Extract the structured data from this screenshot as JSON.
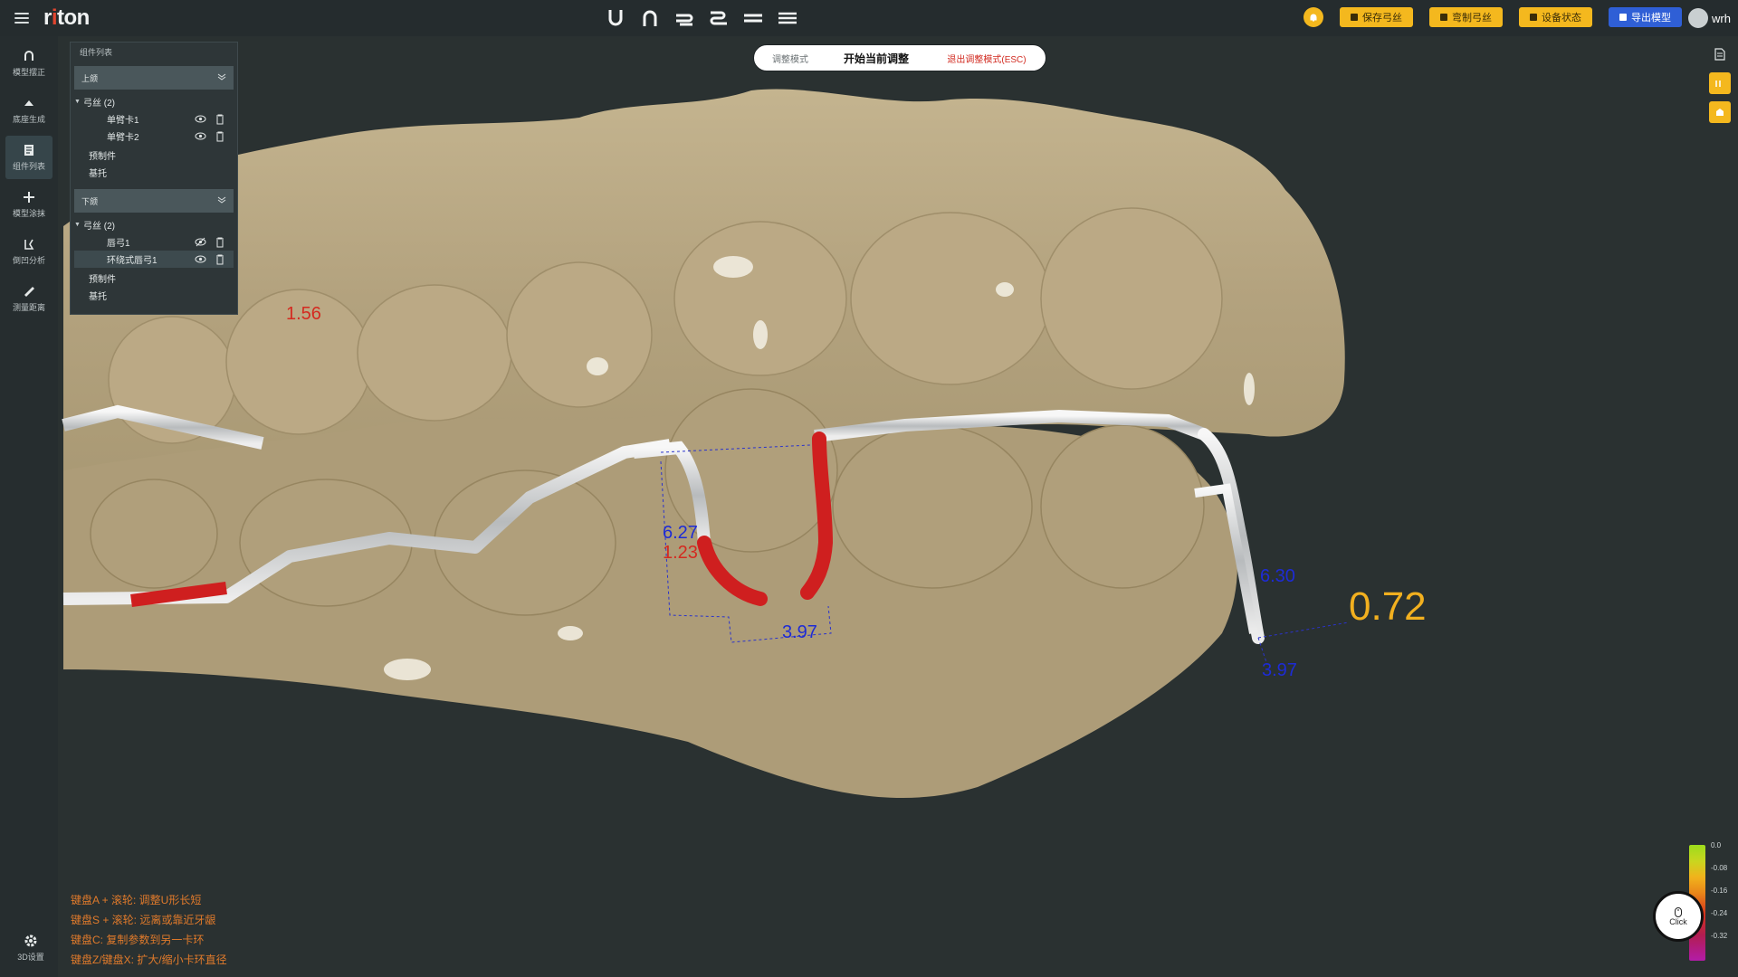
{
  "app": {
    "logo": "riton"
  },
  "toolbar": {
    "home_icon": "bell-icon",
    "buttons": [
      {
        "label": "保存弓丝",
        "style": "yellow"
      },
      {
        "label": "弯制弓丝",
        "style": "yellow"
      },
      {
        "label": "设备状态",
        "style": "yellow"
      },
      {
        "label": "导出模型",
        "style": "blue"
      }
    ],
    "user": "wrh"
  },
  "left_rail": [
    {
      "label": "模型摆正",
      "icon": "arch-icon"
    },
    {
      "label": "底座生成",
      "icon": "base-icon"
    },
    {
      "label": "组件列表",
      "icon": "list-icon",
      "active": true
    },
    {
      "label": "模型涂抹",
      "icon": "brush-icon"
    },
    {
      "label": "倒凹分析",
      "icon": "undercut-icon"
    },
    {
      "label": "测量距离",
      "icon": "ruler-icon"
    }
  ],
  "settings": {
    "label": "3D设置"
  },
  "component_panel": {
    "title": "组件列表",
    "upper": {
      "label": "上颌",
      "wire_group": "弓丝 (2)",
      "items": [
        "单臂卡1",
        "单臂卡2"
      ],
      "prefab": "预制件",
      "base": "基托"
    },
    "lower": {
      "label": "下颌",
      "wire_group": "弓丝 (2)",
      "items": [
        "唇弓1",
        "环绕式唇弓1"
      ],
      "prefab": "预制件",
      "base": "基托"
    }
  },
  "mode_bar": {
    "mode": "调整模式",
    "start": "开始当前调整",
    "exit": "退出调整模式(ESC)"
  },
  "measurements": [
    {
      "value": "1.56",
      "color": "#d42a20"
    },
    {
      "value": "6.27",
      "color": "#1d2bd6"
    },
    {
      "value": "1.23",
      "color": "#d42a20"
    },
    {
      "value": "3.97",
      "color": "#1d2bd6"
    },
    {
      "value": "6.30",
      "color": "#1d2bd6"
    },
    {
      "value": "3.97",
      "color": "#1d2bd6"
    },
    {
      "value": "0.72",
      "color": "#f2b01f"
    }
  ],
  "hints": [
    "键盘A + 滚轮: 调整U形长短",
    "键盘S + 滚轮: 远离或靠近牙龈",
    "键盘C: 复制参数到另一卡环",
    "键盘Z/键盘X: 扩大/缩小卡环直径"
  ],
  "color_scale": [
    "0.0",
    "-0.08",
    "-0.16",
    "-0.24",
    "-0.32"
  ],
  "click_button": {
    "label": "Click"
  },
  "colors": {
    "model": "#b7a683",
    "background": "#2a3131",
    "accent": "#f4b81e",
    "wire_warning": "#cf1f1f"
  }
}
